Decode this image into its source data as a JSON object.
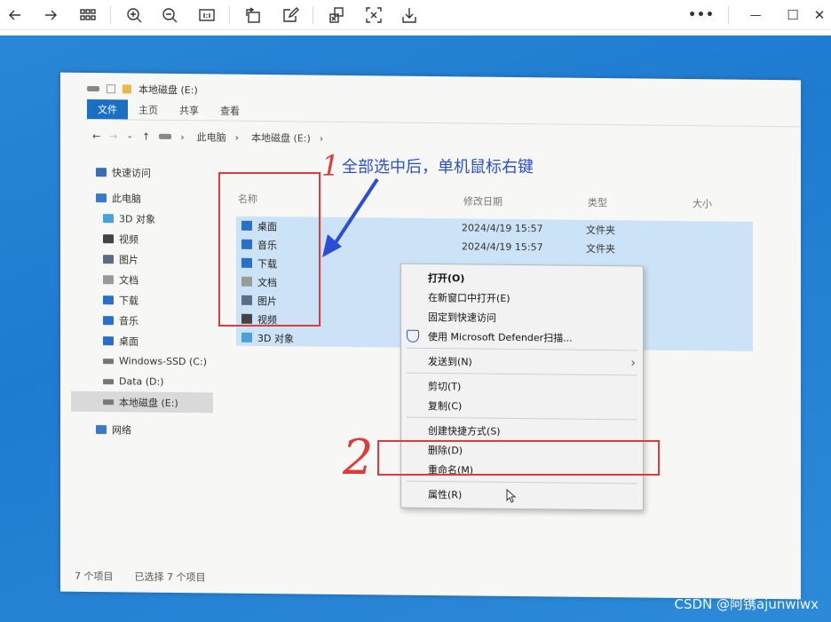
{
  "toolbar": {
    "back": "back-arrow-icon",
    "forward": "forward-arrow-icon",
    "grid": "grid-icon",
    "zoom_in": "zoom-in-icon",
    "zoom_out": "zoom-out-icon",
    "actual_size": "actual-size-icon",
    "rotate": "rotate-icon",
    "edit": "edit-icon",
    "ocr": "ocr-icon",
    "crop": "crop-icon",
    "save": "save-icon",
    "more": "•••",
    "minimize": "—",
    "maximize": "☐",
    "close": "✕"
  },
  "explorer": {
    "title": "本地磁盘 (E:)",
    "ribbon_tabs": [
      "文件",
      "主页",
      "共享",
      "查看"
    ],
    "address": [
      "此电脑",
      "本地磁盘 (E:)"
    ],
    "nav_items": [
      {
        "label": "快速访问",
        "color": "#3a6ebd"
      },
      {
        "label": "此电脑",
        "color": "#3a78c8"
      },
      {
        "label": "3D 对象",
        "color": "#4aa0d8"
      },
      {
        "label": "视频",
        "color": "#444444"
      },
      {
        "label": "图片",
        "color": "#5a6e86"
      },
      {
        "label": "文档",
        "color": "#9a9a9a"
      },
      {
        "label": "下载",
        "color": "#2a6fc9"
      },
      {
        "label": "音乐",
        "color": "#2a6fc9"
      },
      {
        "label": "桌面",
        "color": "#2a6fc9"
      },
      {
        "label": "Windows-SSD (C:)",
        "color": "#777777"
      },
      {
        "label": "Data (D:)",
        "color": "#777777"
      },
      {
        "label": "本地磁盘 (E:)",
        "color": "#777777"
      },
      {
        "label": "网络",
        "color": "#3a78c8"
      }
    ],
    "columns": {
      "name": "名称",
      "date": "修改日期",
      "type": "类型",
      "size": "大小"
    },
    "files": [
      {
        "name": "桌面",
        "date": "2024/4/19 15:57",
        "type": "文件夹",
        "color": "#2a6fc9"
      },
      {
        "name": "音乐",
        "date": "2024/4/19 15:57",
        "type": "文件夹",
        "color": "#2a6fc9"
      },
      {
        "name": "下载",
        "date": "",
        "type": "",
        "color": "#2a6fc9"
      },
      {
        "name": "文档",
        "date": "",
        "type": "",
        "color": "#9a9a9a"
      },
      {
        "name": "图片",
        "date": "",
        "type": "",
        "color": "#5a6e86"
      },
      {
        "name": "视频",
        "date": "",
        "type": "",
        "color": "#444444"
      },
      {
        "name": "3D 对象",
        "date": "",
        "type": "",
        "color": "#4aa0d8"
      }
    ],
    "context_menu": {
      "open": "打开(O)",
      "open_new_window": "在新窗口中打开(E)",
      "pin_quick": "固定到快速访问",
      "defender": "使用 Microsoft Defender扫描...",
      "send_to": "发送到(N)",
      "cut": "剪切(T)",
      "copy": "复制(C)",
      "shortcut": "创建快捷方式(S)",
      "delete": "删除(D)",
      "rename": "重命名(M)",
      "properties": "属性(R)"
    },
    "status": {
      "count": "7 个项目",
      "selected": "已选择 7 个项目"
    }
  },
  "annotations": {
    "step1_number": "1",
    "step1_text": "全部选中后，单机鼠标右键",
    "step2_number": "2"
  },
  "watermark": "CSDN @阿镌ajunwiwx"
}
